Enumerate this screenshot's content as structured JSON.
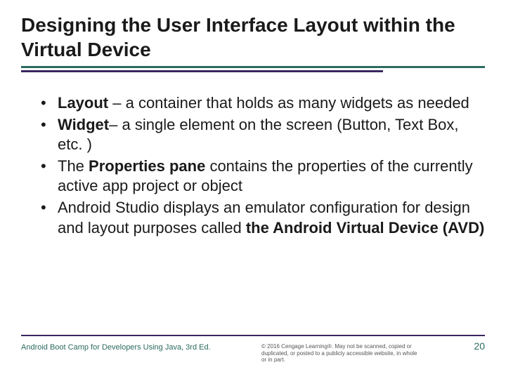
{
  "title": "Designing the User Interface Layout within the Virtual Device",
  "bullets": [
    {
      "term": "Layout",
      "sep": " – ",
      "rest": "a container that holds as many widgets as needed"
    },
    {
      "term": "Widget",
      "sep": "– ",
      "rest": "a single element on the screen (Button, Text Box, etc. )"
    },
    {
      "pre": "The ",
      "term": "Properties pane",
      "sep": " ",
      "rest": "contains the properties of the currently active app project or object"
    },
    {
      "pre": "Android Studio displays an emulator configuration for design and layout purposes called ",
      "term": "the Android Virtual Device (AVD)",
      "sep": "",
      "rest": ""
    }
  ],
  "footer": {
    "left": "Android Boot Camp for Developers Using Java, 3rd Ed.",
    "center": "© 2016 Cengage Learning®. May not be scanned, copied or duplicated, or posted to a publicly accessible website, in whole or in part.",
    "page": "20"
  }
}
